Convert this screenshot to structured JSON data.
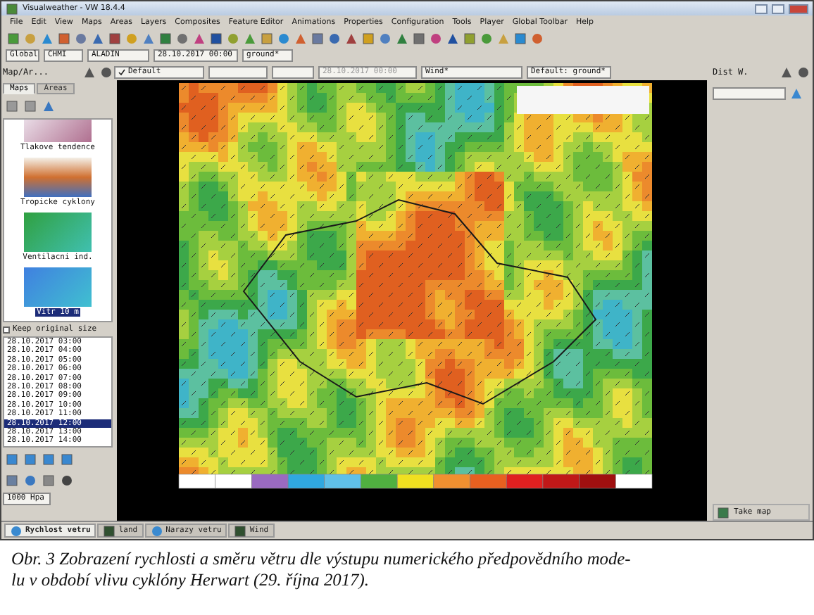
{
  "window": {
    "title": "Visualweather - VW 18.4.4"
  },
  "menu": [
    "File",
    "Edit",
    "View",
    "Maps",
    "Areas",
    "Layers",
    "Composites",
    "Feature Editor",
    "Animations",
    "Properties",
    "Configuration",
    "Tools",
    "Player",
    "Global Toolbar",
    "Help"
  ],
  "selectors": [
    {
      "value": "Global"
    },
    {
      "value": "CHMI"
    },
    {
      "value": "ALADIN"
    },
    {
      "value": "28.10.2017 00:00"
    },
    {
      "value": "ground*"
    }
  ],
  "left_panel": {
    "title": "Map/Ar...",
    "tabs": [
      {
        "label": "Maps",
        "selected": true
      },
      {
        "label": "Areas",
        "selected": false
      }
    ],
    "thumbnails": [
      {
        "label": "Tlakove tendence",
        "selected": false
      },
      {
        "label": "Tropicke cyklony",
        "selected": false
      },
      {
        "label": "Ventilacni ind.",
        "selected": false
      },
      {
        "label": "Vitr 10 m",
        "selected": true
      }
    ],
    "keep_size": {
      "label": "Keep original size",
      "checked": false
    },
    "times": [
      {
        "label": "28.10.2017 03:00",
        "selected": false
      },
      {
        "label": "28.10.2017 04:00",
        "selected": false
      },
      {
        "label": "28.10.2017 05:00",
        "selected": false
      },
      {
        "label": "28.10.2017 06:00",
        "selected": false
      },
      {
        "label": "28.10.2017 07:00",
        "selected": false
      },
      {
        "label": "28.10.2017 08:00",
        "selected": false
      },
      {
        "label": "28.10.2017 09:00",
        "selected": false
      },
      {
        "label": "28.10.2017 10:00",
        "selected": false
      },
      {
        "label": "28.10.2017 11:00",
        "selected": false
      },
      {
        "label": "28.10.2017 12:00",
        "selected": true
      },
      {
        "label": "28.10.2017 13:00",
        "selected": false
      },
      {
        "label": "28.10.2017 14:00",
        "selected": false
      }
    ],
    "level": "1000 Hpa"
  },
  "map_toolbar": [
    {
      "value": "Default",
      "checked": true,
      "disabled": false
    },
    {
      "checked": false
    },
    {
      "checked": false
    },
    {
      "value": "28.10.2017 00:00",
      "disabled": true
    },
    {
      "value": "Wind*",
      "disabled": false
    },
    {
      "value": "Default: ground*",
      "disabled": false
    }
  ],
  "right_panel": {
    "title": "Dist W.",
    "item": "Take map"
  },
  "layer_tabs": [
    {
      "label": "Rychlost vetru",
      "selected": true
    },
    {
      "label": "land",
      "selected": false
    },
    {
      "label": "Narazy vetru",
      "selected": false
    },
    {
      "label": "Wind",
      "selected": false
    }
  ],
  "caption": [
    "Obr. 3 Zobrazení rychlosti a směru větru dle výstupu numerického předpovědního mode-",
    "lu v období vlivu cyklóny Herwart (29. října 2017)."
  ]
}
